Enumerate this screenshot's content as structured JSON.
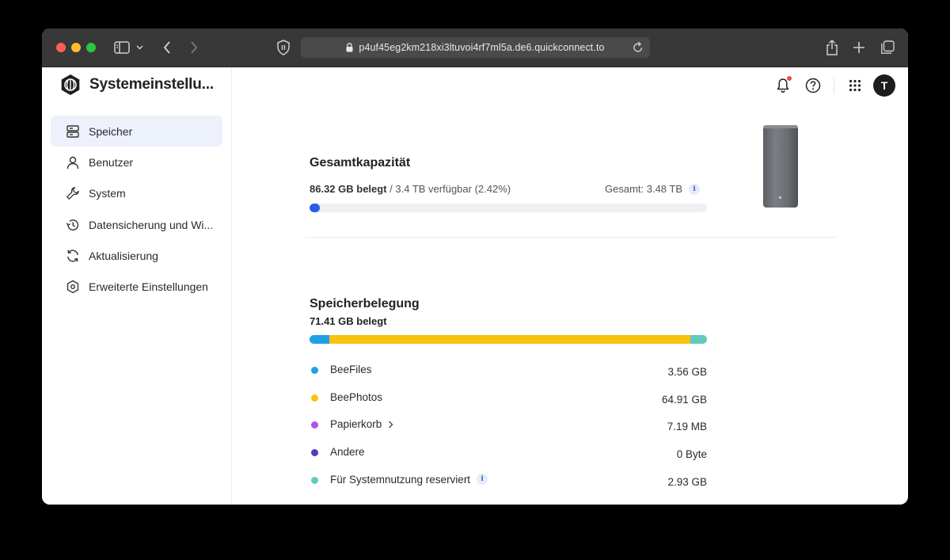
{
  "browser": {
    "url": "p4uf45eg2km218xi3ltuvoi4rf7ml5a.de6.quickconnect.to"
  },
  "app": {
    "title": "Systemeinstellu...",
    "nav": [
      {
        "label": "Speicher",
        "icon": "storage-icon",
        "active": true
      },
      {
        "label": "Benutzer",
        "icon": "user-icon",
        "active": false
      },
      {
        "label": "System",
        "icon": "wrench-icon",
        "active": false
      },
      {
        "label": "Datensicherung und Wi...",
        "icon": "backup-restore-icon",
        "active": false
      },
      {
        "label": "Aktualisierung",
        "icon": "update-icon",
        "active": false
      },
      {
        "label": "Erweiterte Einstellungen",
        "icon": "advanced-settings-icon",
        "active": false
      }
    ],
    "avatar_letter": "T"
  },
  "capacity": {
    "title": "Gesamtkapazität",
    "used": "86.32 GB belegt",
    "available": " / 3.4 TB verfügbar (2.42%)",
    "total": "Gesamt: 3.48 TB",
    "used_fraction": 0.0242,
    "bar_color": "#2b5de0"
  },
  "usage": {
    "title": "Speicherbelegung",
    "used": "71.41 GB belegt",
    "items": [
      {
        "name": "BeeFiles",
        "size": "3.56 GB",
        "color": "#1ea0e6",
        "share": 0.0499,
        "chevron": false,
        "info": false
      },
      {
        "name": "BeePhotos",
        "size": "64.91 GB",
        "color": "#f8c20e",
        "share": 0.909,
        "chevron": false,
        "info": false
      },
      {
        "name": "Papierkorb",
        "size": "7.19 MB",
        "color": "#b452e8",
        "share": 0.0001,
        "chevron": true,
        "info": false
      },
      {
        "name": "Andere",
        "size": "0 Byte",
        "color": "#4b3fb8",
        "share": 0,
        "chevron": false,
        "info": false
      },
      {
        "name": "Für Systemnutzung reserviert",
        "size": "2.93 GB",
        "color": "#62c9bf",
        "share": 0.041,
        "chevron": false,
        "info": true
      }
    ]
  }
}
